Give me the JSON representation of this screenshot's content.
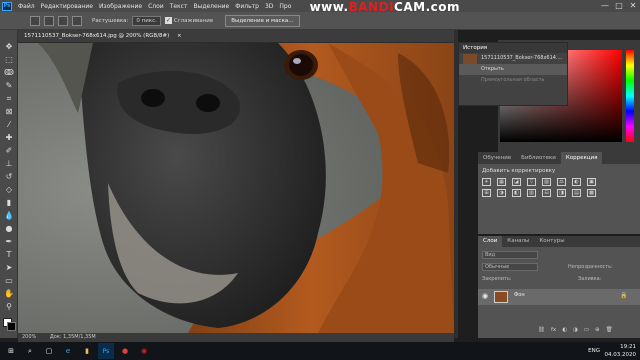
{
  "menubar": {
    "logo": "Ps",
    "items": [
      "Файл",
      "Редактирование",
      "Изображение",
      "Слои",
      "Текст",
      "Выделение",
      "Фильтр",
      "3D",
      "Про"
    ],
    "window_controls": [
      "—",
      "□",
      "✕"
    ]
  },
  "watermark": {
    "text": "www.BANDICAM.com",
    "prefix": "www.",
    "brand": "BANDI",
    "suffix": "CAM.com"
  },
  "options": {
    "feather_label": "Растушевка:",
    "feather_value": "0 пикс.",
    "smoothing_label": "Сглаживание",
    "select_mask_button": "Выделение и маска..."
  },
  "document": {
    "tab_title": "1571110537_Bokser-768x614.jpg @ 200% (RGB/8#)",
    "close": "×",
    "status_zoom": "200%",
    "status_doc": "Док: 1,35M/1,35M"
  },
  "history": {
    "title": "История",
    "snapshot": "1571110537_Bokser-768x614....",
    "items": [
      "Открыть",
      "Прямоугольная область"
    ]
  },
  "adjustments": {
    "tabs": [
      "Обучение",
      "Библиотеки",
      "Коррекция"
    ],
    "add_label": "Добавить корректировку",
    "icons": [
      "☀",
      "▦",
      "◪",
      "▽",
      "▨",
      "⚖",
      "◐",
      "▣",
      "⊞",
      "◑",
      "◧",
      "▥",
      "⊟",
      "◨",
      "▤",
      "▩"
    ]
  },
  "layers": {
    "tabs": [
      "Слои",
      "Каналы",
      "Контуры"
    ],
    "search_placeholder": "Вид",
    "blend_mode": "Обычные",
    "opacity_label": "Непрозрачность:",
    "lock_label": "Закрепить:",
    "fill_label": "Заливка:",
    "layer_name": "Фон",
    "footer_icons": [
      "⛓",
      "fx",
      "◐",
      "◑",
      "▭",
      "⊕",
      "🗑"
    ]
  },
  "taskbar": {
    "lang": "ENG",
    "time": "19:21",
    "date": "04.03.2020",
    "apps": [
      "⊞",
      "⌕",
      "▢",
      "e",
      "▮",
      "Ps",
      "●",
      "◉"
    ]
  },
  "colors": {
    "brand_blue": "#31a8ff",
    "bandicam_red": "#e02020",
    "fur_orange": "#b35a1f"
  }
}
